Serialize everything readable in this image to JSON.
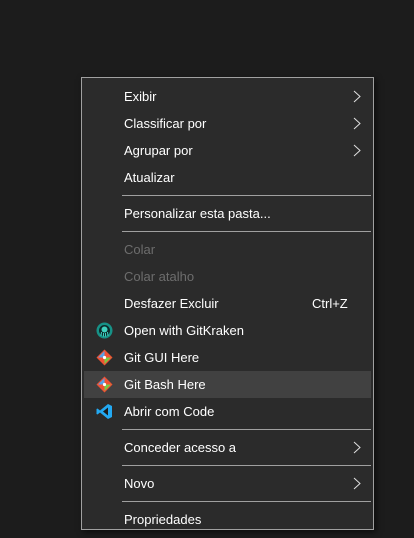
{
  "context_menu": {
    "items": [
      {
        "label": "Exibir"
      },
      {
        "label": "Classificar por"
      },
      {
        "label": "Agrupar por"
      },
      {
        "label": "Atualizar"
      },
      {
        "label": "Personalizar esta pasta..."
      },
      {
        "label": "Colar"
      },
      {
        "label": "Colar atalho"
      },
      {
        "label": "Desfazer Excluir",
        "shortcut": "Ctrl+Z"
      },
      {
        "label": "Open with GitKraken",
        "icon": "gitkraken-icon"
      },
      {
        "label": "Git GUI Here",
        "icon": "git-icon"
      },
      {
        "label": "Git Bash Here",
        "icon": "git-icon"
      },
      {
        "label": "Abrir com Code",
        "icon": "vscode-icon"
      },
      {
        "label": "Conceder acesso a"
      },
      {
        "label": "Novo"
      },
      {
        "label": "Propriedades"
      }
    ]
  },
  "colors": {
    "menu_background": "#2b2b2b",
    "border": "#a0a0a0",
    "text": "#ffffff",
    "disabled_text": "#6d6d6d",
    "hover_background": "#414141",
    "git_orange": "#f05133",
    "vscode_blue": "#23a9f2",
    "gitkraken_teal": "#179287"
  }
}
